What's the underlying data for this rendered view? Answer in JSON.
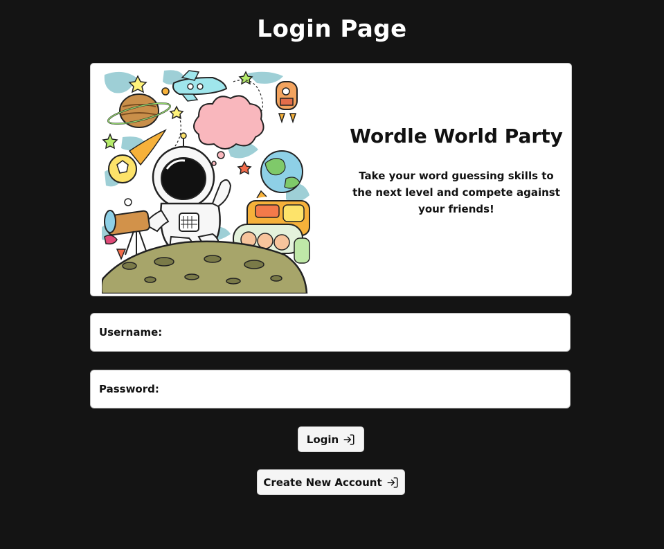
{
  "header": {
    "title": "Login Page"
  },
  "hero": {
    "title": "Wordle World Party",
    "description": "Take your word guessing skills to the next level and compete against your friends!",
    "illustration": "astronaut-space-doodle"
  },
  "form": {
    "username_label": "Username:",
    "username_value": "",
    "password_label": "Password:",
    "password_value": ""
  },
  "actions": {
    "login_label": "Login",
    "login_icon": "login-icon",
    "create_account_label": "Create New Account",
    "create_account_icon": "login-icon"
  },
  "colors": {
    "background": "#141414",
    "card": "#ffffff",
    "button": "#f5f5f5",
    "text_dark": "#111111",
    "text_light": "#ffffff"
  }
}
